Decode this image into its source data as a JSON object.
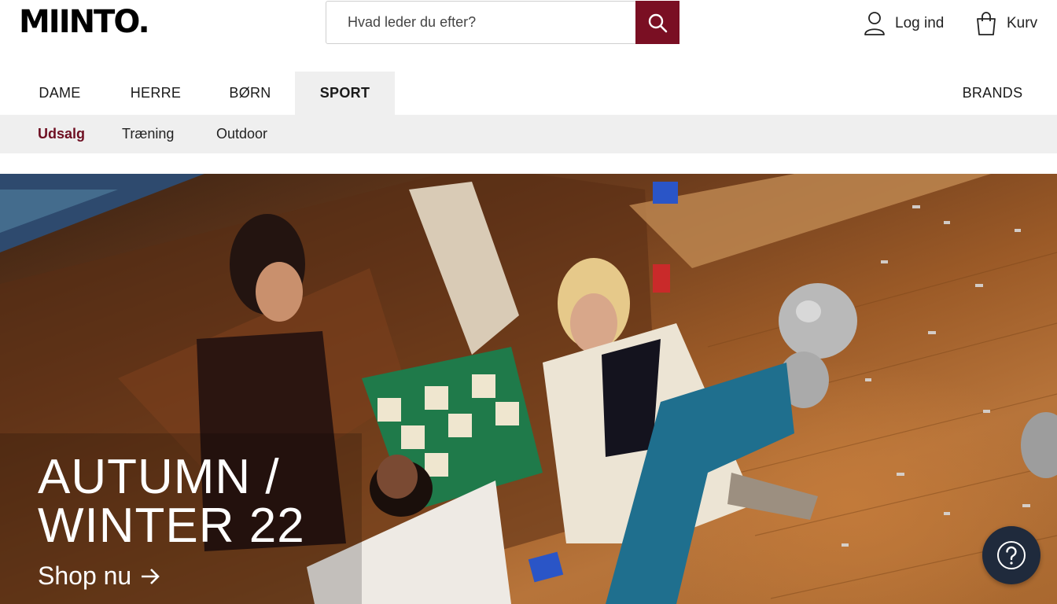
{
  "header": {
    "logo": "MIINTO.",
    "search": {
      "placeholder": "Hvad leder du efter?",
      "value": ""
    },
    "login_label": "Log ind",
    "cart_label": "Kurv"
  },
  "main_nav": {
    "items": [
      {
        "label": "DAME"
      },
      {
        "label": "HERRE"
      },
      {
        "label": "BØRN"
      },
      {
        "label": "SPORT",
        "active": true
      },
      {
        "label": "BRANDS"
      }
    ]
  },
  "sub_nav": {
    "items": [
      {
        "label": "Udsalg",
        "highlight": true
      },
      {
        "label": "Træning"
      },
      {
        "label": "Outdoor"
      }
    ]
  },
  "hero": {
    "title": "AUTUMN /\nWINTER 22",
    "cta_label": "Shop nu"
  },
  "colors": {
    "brand_accent": "#7a0f23",
    "subnav_bg": "#efefef",
    "help_button": "#1f2a3c"
  },
  "icons": {
    "search": "search-icon",
    "login": "user-icon",
    "cart": "shopping-bag-icon",
    "cta": "arrow-right-icon",
    "help": "question-mark-icon"
  }
}
